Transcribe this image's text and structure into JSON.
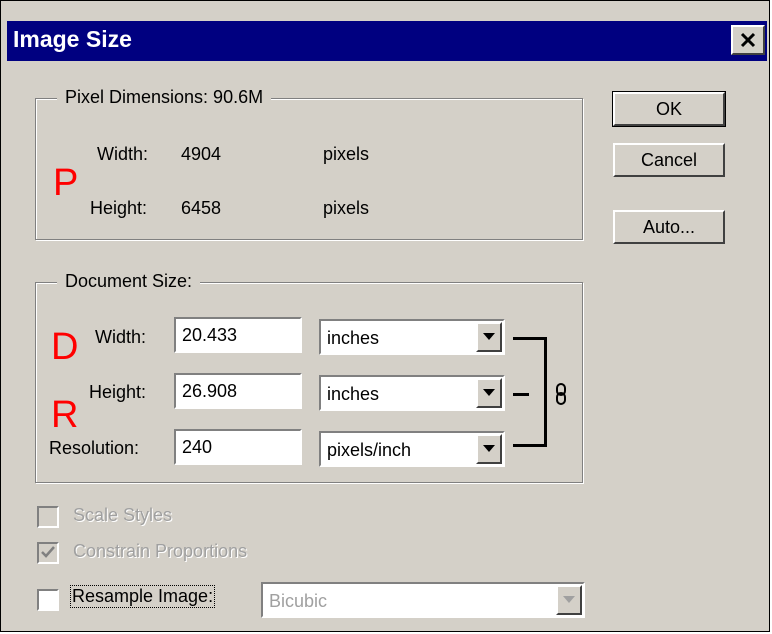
{
  "dialog": {
    "title": "Image Size",
    "close_symbol": "×"
  },
  "pixel_dimensions": {
    "legend": "Pixel Dimensions:  90.6M",
    "width_label": "Width:",
    "width_value": "4904",
    "width_unit": "pixels",
    "height_label": "Height:",
    "height_value": "6458",
    "height_unit": "pixels"
  },
  "document_size": {
    "legend": "Document Size:",
    "width_label": "Width:",
    "width_value": "20.433",
    "width_unit": "inches",
    "height_label": "Height:",
    "height_value": "26.908",
    "height_unit": "inches",
    "resolution_label": "Resolution:",
    "resolution_value": "240",
    "resolution_unit": "pixels/inch"
  },
  "annotations": {
    "p": "P",
    "d": "D",
    "r": "R",
    "color": "#ff0000"
  },
  "buttons": {
    "ok": "OK",
    "cancel": "Cancel",
    "auto": "Auto..."
  },
  "options": {
    "scale_styles_label": "Scale Styles",
    "scale_styles_checked": false,
    "scale_styles_enabled": false,
    "constrain_label": "Constrain Proportions",
    "constrain_checked": true,
    "constrain_enabled": false,
    "resample_label": "Resample Image:",
    "resample_checked": false,
    "resample_method": "Bicubic"
  },
  "icons": {
    "link": "chain-link-icon",
    "dropdown": "dropdown-arrow-icon",
    "close": "close-icon",
    "check": "checkmark-icon"
  },
  "colors": {
    "titlebar": "#000080",
    "dialog_bg": "#d4d0c8",
    "annotation": "#ff0000"
  }
}
